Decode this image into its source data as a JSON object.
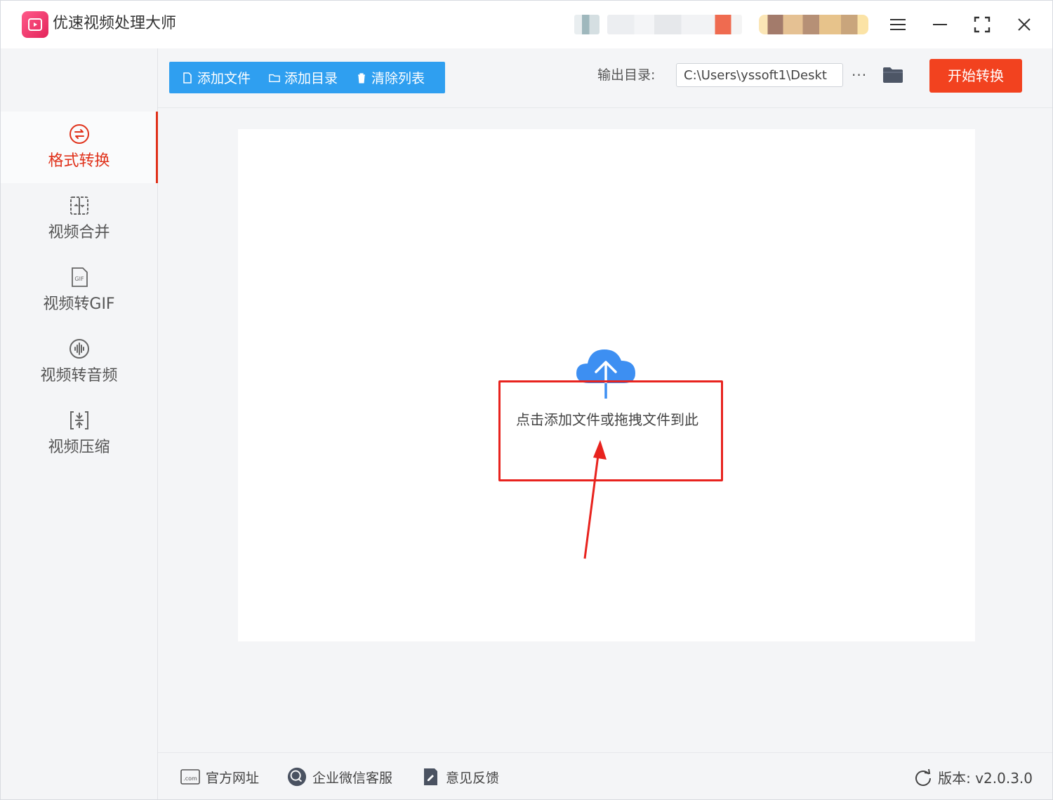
{
  "app": {
    "title": "优速视频处理大师"
  },
  "toolbar": {
    "add_file": "添加文件",
    "add_dir": "添加目录",
    "clear_list": "清除列表",
    "output_label": "输出目录:",
    "output_path": "C:\\Users\\yssoft1\\Deskt",
    "more": "···",
    "start": "开始转换"
  },
  "sidebar": {
    "items": [
      {
        "label": "格式转换",
        "icon": "convert-icon",
        "active": true
      },
      {
        "label": "视频合并",
        "icon": "merge-icon"
      },
      {
        "label": "视频转GIF",
        "icon": "gif-icon"
      },
      {
        "label": "视频转音频",
        "icon": "audio-icon"
      },
      {
        "label": "视频压缩",
        "icon": "compress-icon"
      }
    ]
  },
  "drop": {
    "hint": "点击添加文件或拖拽文件到此"
  },
  "footer": {
    "website": "官方网址",
    "wechat": "企业微信客服",
    "feedback": "意见反馈",
    "version": "版本: v2.0.3.0"
  },
  "colors": {
    "accent_blue": "#2f9ff0",
    "accent_red": "#f2421f",
    "active_red": "#e0321b",
    "annotation_red": "#e8231e"
  }
}
